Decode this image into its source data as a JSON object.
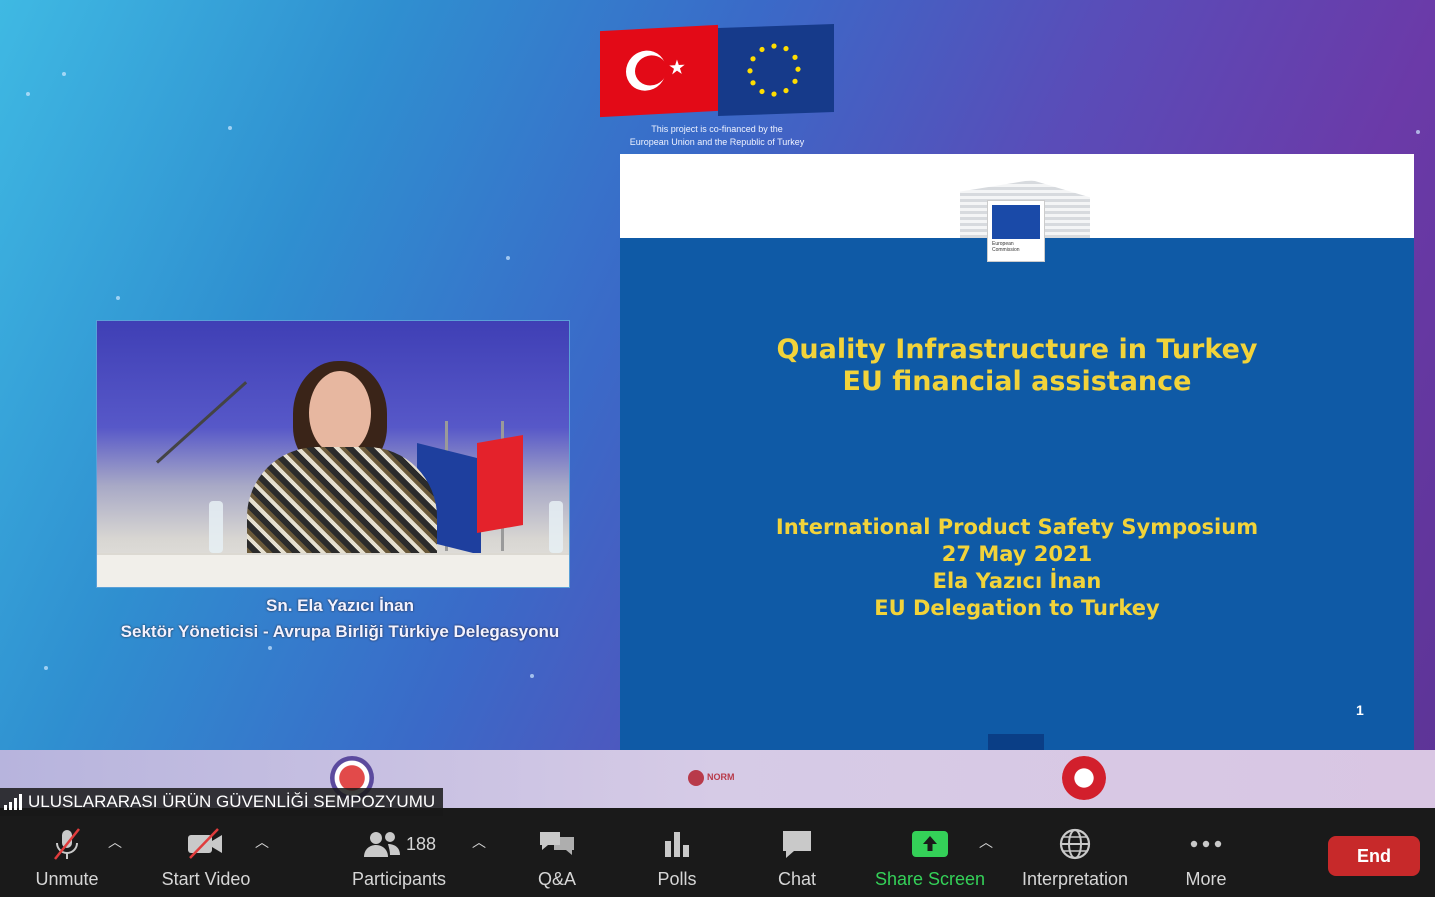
{
  "meeting": {
    "name": "ULUSLARARASI ÜRÜN GÜVENLİĞİ SEMPOZYUMU"
  },
  "flags_caption": {
    "line1": "This project is co-financed by the",
    "line2": "European Union and the Republic of Turkey"
  },
  "speaker": {
    "name": "Sn. Ela Yazıcı İnan",
    "title": "Sektör Yöneticisi - Avrupa Birliği Türkiye Delegasyonu"
  },
  "slide": {
    "logo_text_1": "European",
    "logo_text_2": "Commission",
    "title_line1": "Quality Infrastructure in Turkey",
    "title_line2": "EU financial assistance",
    "sub_line1": "International Product Safety Symposium",
    "sub_line2": "27 May 2021",
    "sub_line3": "Ela Yazıcı İnan",
    "sub_line4": "EU Delegation to Turkey",
    "page_number": "1"
  },
  "strip": {
    "mid_logo_text": "NORM"
  },
  "toolbar": {
    "unmute_label": "Unmute",
    "start_video_label": "Start Video",
    "participants_label": "Participants",
    "participants_count": "188",
    "qa_label": "Q&A",
    "polls_label": "Polls",
    "chat_label": "Chat",
    "share_screen_label": "Share Screen",
    "interpretation_label": "Interpretation",
    "more_label": "More",
    "end_label": "End"
  },
  "colors": {
    "toolbar_bg": "#1a1a1a",
    "end_button": "#c7292a",
    "share_accent": "#34d058",
    "slide_bg": "#0f5aa6",
    "slide_text": "#f2d33a"
  },
  "icons": {
    "unmute": "microphone-muted-icon",
    "start_video": "video-camera-off-icon",
    "participants": "people-icon",
    "qa": "speech-bubbles-icon",
    "polls": "bar-chart-icon",
    "chat": "chat-bubble-icon",
    "share_screen": "share-arrow-up-icon",
    "interpretation": "globe-icon",
    "more": "ellipsis-icon",
    "signal": "signal-bars-icon"
  }
}
